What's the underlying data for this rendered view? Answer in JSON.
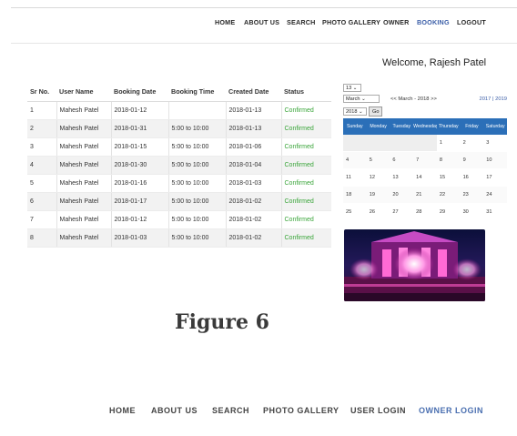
{
  "top_nav": {
    "items": [
      "HOME",
      "ABOUT US",
      "SEARCH",
      "PHOTO GALLERY",
      "OWNER",
      "BOOKING",
      "LOGOUT"
    ],
    "active": "BOOKING"
  },
  "welcome": "Welcome, Rajesh Patel",
  "bookings_table": {
    "columns": [
      "Sr No.",
      "User Name",
      "Booking Date",
      "Booking Time",
      "Created Date",
      "Status"
    ],
    "rows": [
      [
        "1",
        "Mahesh Patel",
        "2018-01-12",
        "",
        "2018-01-13",
        "Confirmed"
      ],
      [
        "2",
        "Mahesh Patel",
        "2018-01-31",
        "5:00 to 10:00",
        "2018-01-13",
        "Confirmed"
      ],
      [
        "3",
        "Mahesh Patel",
        "2018-01-15",
        "5:00 to 10:00",
        "2018-01-06",
        "Confirmed"
      ],
      [
        "4",
        "Mahesh Patel",
        "2018-01-30",
        "5:00 to 10:00",
        "2018-01-04",
        "Confirmed"
      ],
      [
        "5",
        "Mahesh Patel",
        "2018-01-16",
        "5:00 to 10:00",
        "2018-01-03",
        "Confirmed"
      ],
      [
        "6",
        "Mahesh Patel",
        "2018-01-17",
        "5:00 to 10:00",
        "2018-01-02",
        "Confirmed"
      ],
      [
        "7",
        "Mahesh Patel",
        "2018-01-12",
        "5:00 to 10:00",
        "2018-01-02",
        "Confirmed"
      ],
      [
        "8",
        "Mahesh Patel",
        "2018-01-03",
        "5:00 to 10:00",
        "2018-01-02",
        "Confirmed"
      ]
    ]
  },
  "calendar": {
    "day_select": "13",
    "month_select": "March",
    "year_select": "2018",
    "go_label": "Go",
    "title": "<< March - 2018 >>",
    "year_links": "2017 | 2019",
    "weekdays": [
      "Sunday",
      "Monday",
      "Tuesday",
      "Wednesday",
      "Thursday",
      "Friday",
      "Saturday"
    ],
    "cells": [
      "",
      "",
      "",
      "",
      "1",
      "2",
      "3",
      "4",
      "5",
      "6",
      "7",
      "8",
      "9",
      "10",
      "11",
      "12",
      "13",
      "14",
      "15",
      "16",
      "17",
      "18",
      "19",
      "20",
      "21",
      "22",
      "23",
      "24",
      "25",
      "26",
      "27",
      "28",
      "29",
      "30",
      "31"
    ],
    "header_color": "#2b6fb8"
  },
  "figure_caption": "Figure 6",
  "bottom_nav": {
    "items": [
      "HOME",
      "ABOUT US",
      "SEARCH",
      "PHOTO GALLERY",
      "USER LOGIN",
      "OWNER LOGIN"
    ],
    "active": "OWNER LOGIN"
  },
  "colors": {
    "confirmed": "#3aa53a",
    "accent": "#3b5ea8"
  }
}
